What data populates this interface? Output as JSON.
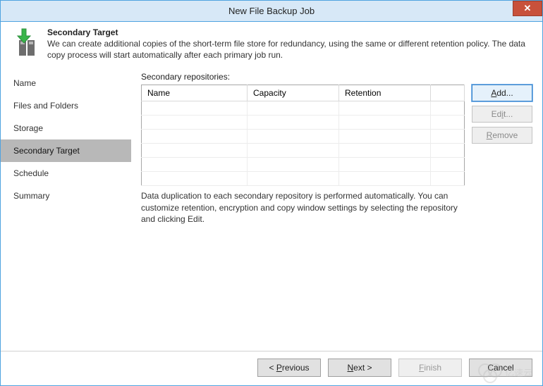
{
  "window": {
    "title": "New File Backup Job"
  },
  "header": {
    "title": "Secondary Target",
    "description": "We can create additional copies of the short-term file store for redundancy, using the same or different retention policy. The data copy process will start automatically after each primary job run."
  },
  "nav": [
    "Name",
    "Files and Folders",
    "Storage",
    "Secondary Target",
    "Schedule",
    "Summary"
  ],
  "content": {
    "label": "Secondary repositories:",
    "columns": [
      "Name",
      "Capacity",
      "Retention"
    ],
    "rows": [],
    "hint": "Data duplication to each secondary repository is performed automatically. You can customize retention, encryption and copy window settings by selecting the repository and clicking Edit."
  },
  "buttons": {
    "add": {
      "accel": "A",
      "rest": "dd..."
    },
    "edit": {
      "pre": "Ed",
      "accel": "i",
      "rest": "t..."
    },
    "remove": {
      "accel": "R",
      "rest": "emove"
    }
  },
  "footer": {
    "previous": {
      "accel": "P",
      "rest": "revious"
    },
    "next": {
      "accel": "N",
      "rest": "ext"
    },
    "finish": {
      "accel": "F",
      "rest": "inish"
    },
    "cancel": "Cancel"
  }
}
